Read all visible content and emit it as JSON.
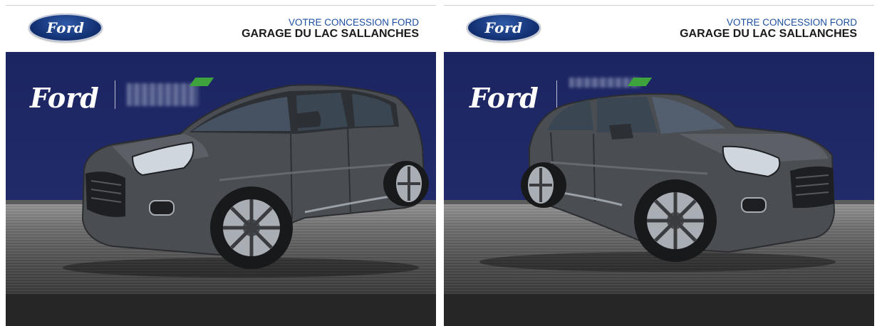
{
  "gallery": {
    "photos": [
      {
        "header": {
          "tagline": "VOTRE CONCESSION FORD",
          "dealer": "GARAGE DU LAC SALLANCHES",
          "oval_logo": "Ford"
        },
        "banner": {
          "brand_script": "Ford"
        },
        "view": "front-left"
      },
      {
        "header": {
          "tagline": "VOTRE CONCESSION FORD",
          "dealer": "GARAGE DU LAC SALLANCHES",
          "oval_logo": "Ford"
        },
        "banner": {
          "brand_script": "Ford"
        },
        "view": "front-right"
      }
    ]
  },
  "colors": {
    "ford_blue": "#133275",
    "banner_navy": "#1b2561",
    "tagline_blue": "#1c4fa0",
    "car_grey": "#4a4d52"
  },
  "icons": [
    "ford-oval-logo-icon",
    "ford-script-logo-icon",
    "blurred-partner-logo-icon"
  ]
}
